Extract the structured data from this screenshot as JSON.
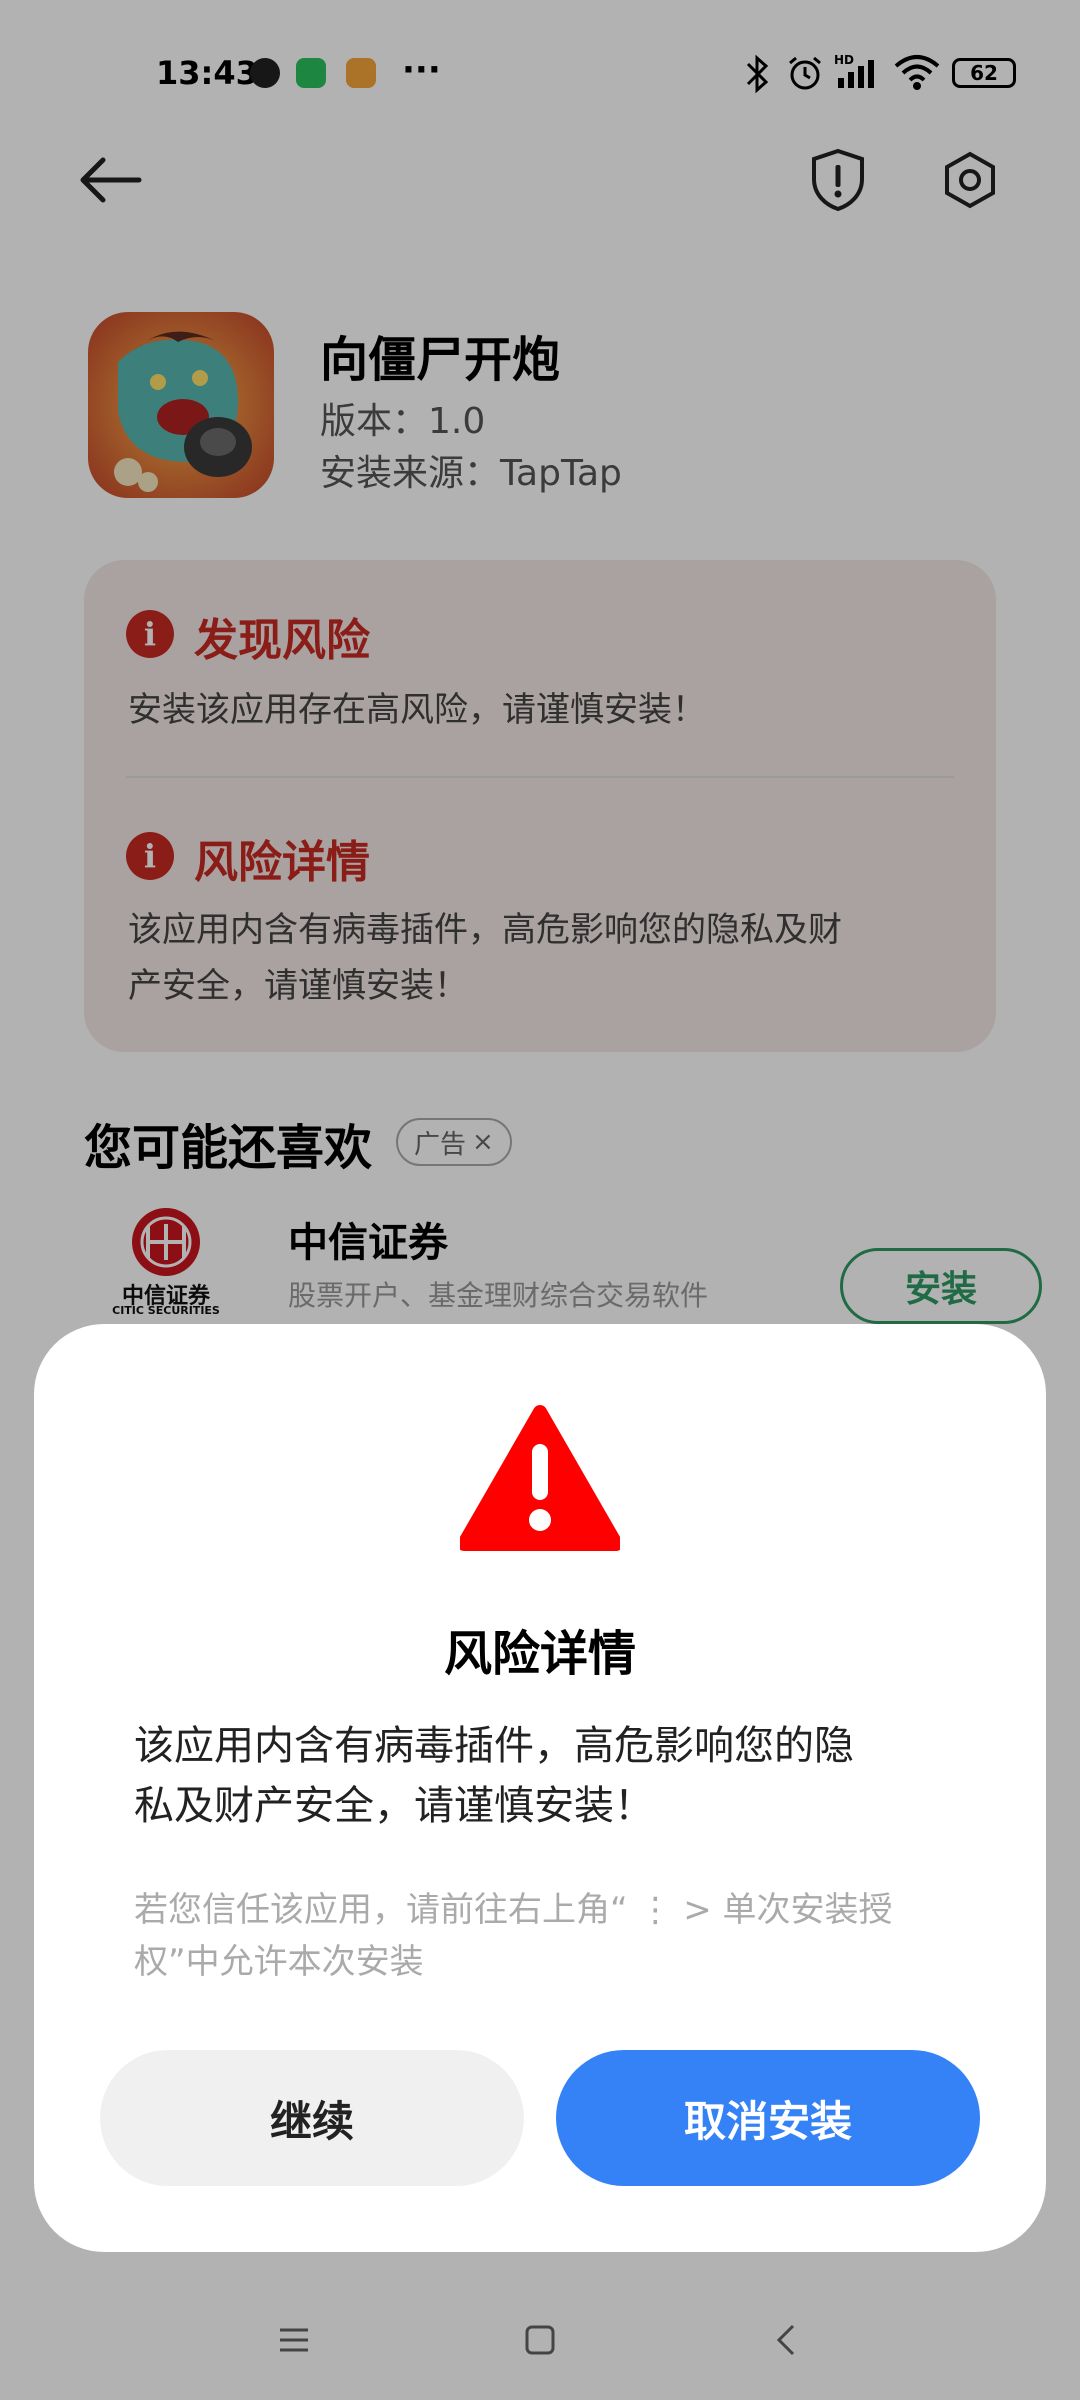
{
  "status_bar": {
    "time": "13:43",
    "battery": "62",
    "icons": [
      "clock-icon",
      "wechat-icon",
      "gallery-icon",
      "more-dots-icon",
      "bluetooth-icon",
      "alarm-icon",
      "hd-signal-icon",
      "wifi-icon",
      "battery-icon"
    ]
  },
  "header": {
    "back_icon": "back-arrow-icon",
    "shield_icon": "shield-exclamation-icon",
    "settings_icon": "settings-hex-icon"
  },
  "app": {
    "name": "向僵尸开炮",
    "version": "版本：1.0",
    "source": "安装来源：TapTap"
  },
  "risk_card": {
    "found_title": "发现风险",
    "found_text": "安装该应用存在高风险，请谨慎安装！",
    "detail_title": "风险详情",
    "detail_line1": "该应用内含有病毒插件，高危影响您的隐私及财",
    "detail_line2": "产安全，请谨慎安装！"
  },
  "recommend": {
    "title": "您可能还喜欢",
    "ad_label": "广告",
    "ad_close": "×",
    "item": {
      "logo_text": "中信证券",
      "logo_sub": "CITIC SECURITIES",
      "name": "中信证券",
      "desc": "股票开户、基金理财综合交易软件",
      "install": "安装"
    }
  },
  "dialog": {
    "title": "风险详情",
    "body_line1": "该应用内含有病毒插件，高危影响您的隐",
    "body_line2": "私及财产安全，请谨慎安装！",
    "note_line1": "若您信任该应用，请前往右上角“ ⋮ > 单次安装授",
    "note_line2": "权”中允许本次安装",
    "continue": "继续",
    "cancel": "取消安装"
  },
  "colors": {
    "risk_red": "#c62a22",
    "warn_red": "#ff0000",
    "primary_blue": "#3482f6",
    "install_green": "#2e9a63"
  },
  "nav": {
    "menu_icon": "menu-lines-icon",
    "home_icon": "home-square-icon",
    "back_icon": "nav-back-icon"
  }
}
